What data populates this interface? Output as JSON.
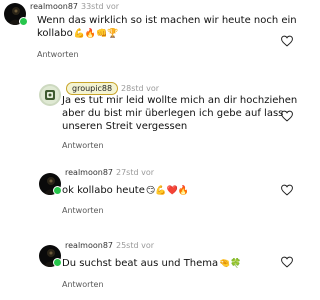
{
  "comments": [
    {
      "username": "realmoon87",
      "time": "33std vor",
      "text_line1": "Wenn das wirklich so ist machen wir heute noch ein",
      "text_line2": "kollabo",
      "emojis": "💪🔥👊🏆",
      "reply": "Antworten"
    },
    {
      "username": "groupic88",
      "time": "28std vor",
      "text_line1": "Ja es tut mir leid wollte mich an dir hochziehen",
      "text_line2": "aber du bist mir überlegen ich gebe auf lass",
      "text_line3": "unseren Streit vergessen",
      "reply": "Antworten"
    },
    {
      "username": "realmoon87",
      "time": "27std vor",
      "text_line1": "ok kollabo heute",
      "emojis": "😏💪❤️🔥",
      "reply": "Antworten"
    },
    {
      "username": "realmoon87",
      "time": "25std vor",
      "text_line1": "Du suchst beat aus und Thema",
      "emojis": "🤏🍀",
      "reply": "Antworten"
    }
  ],
  "colors": {
    "online": "#27c64c",
    "badge_border": "#c8a42a",
    "badge_bg": "#f4f4d2"
  }
}
